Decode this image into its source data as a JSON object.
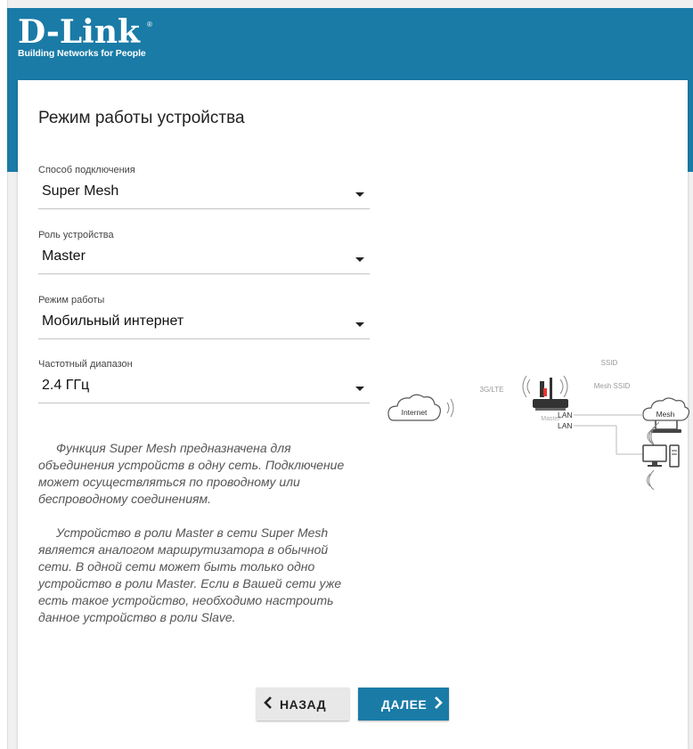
{
  "brand": {
    "name": "D-Link",
    "registered": "®",
    "tagline": "Building Networks for People"
  },
  "page": {
    "title": "Режим работы устройства"
  },
  "fields": [
    {
      "label": "Способ подключения",
      "value": "Super Mesh"
    },
    {
      "label": "Роль устройства",
      "value": "Master"
    },
    {
      "label": "Режим работы",
      "value": "Мобильный интернет"
    },
    {
      "label": "Частотный диапазон",
      "value": "2.4 ГГц"
    }
  ],
  "description": [
    "Функция Super Mesh предназначена для объединения устройств в одну сеть. Подключение может осуществляться по проводному или беспроводному соединениям.",
    "Устройство в роли Master в сети Super Mesh является аналогом маршрутизатора в обычной сети. В одной сети может быть только одно устройство в роли Master. Если в Вашей сети уже есть такое устройство, необходимо настроить данное устройство в роли Slave."
  ],
  "diagram": {
    "internet": "Internet",
    "link": "3G/LTE",
    "master": "Master",
    "ssid": "SSID",
    "mesh_ssid": "Mesh SSID",
    "mesh": "Mesh",
    "lan1": "LAN",
    "lan2": "LAN"
  },
  "buttons": {
    "back": "НАЗАД",
    "next": "ДАЛЕЕ"
  },
  "colors": {
    "brand_blue": "#1a7ba7",
    "back_button_bg": "#e8e8e8"
  },
  "icons": [
    "chevron-left-icon",
    "chevron-right-icon",
    "dropdown-arrow-icon",
    "cloud-icon",
    "router-icon",
    "laptop-icon",
    "desktop-icon",
    "wifi-waves-icon"
  ]
}
